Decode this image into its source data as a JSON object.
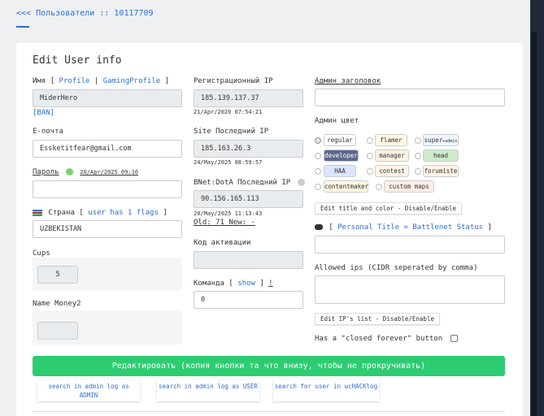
{
  "breadcrumb": "<<< Пользователи :: 10117709",
  "title": "Edit User info",
  "col1": {
    "name_label": "Имя",
    "bracket_open": "[",
    "bracket_close": "]",
    "separator": "|",
    "profile_link": "Profile",
    "gaming_profile_link": "GamingProfile",
    "name_value": "MiderHero",
    "ban_link": "[BAN]",
    "email_label": "E-почта",
    "email_value": "Essketitfear@gmail.com",
    "password_label": "Пароль",
    "password_date": "20/Apr/2025 09:16",
    "password_value": "",
    "country_label": "Страна",
    "country_flags_link": "user has 1 flags",
    "country_value": "UZBEKISTAN",
    "cups_label": "Cups",
    "cups_value": "5",
    "name_money_label": "Name Money2",
    "name_money_value": ""
  },
  "col2": {
    "reg_ip_label": "Регистрационный IP",
    "reg_ip_value": "185.139.137.37",
    "reg_ip_time": "21/Apr/2020 07:54:21",
    "site_ip_label": "Site Последний IP",
    "site_ip_value": "185.163.26.3",
    "site_ip_time": "24/May/2025 08:59:57",
    "bnet_label": "BNet:DotA Последний IP",
    "bnet_value": "90.156.165.113",
    "bnet_time": "20/May/2025 11:13:43",
    "old_new": "Old: 71 New: -",
    "activation_label": "Код активации",
    "activation_value": "",
    "team_label": "Команда",
    "team_show_link": "show",
    "team_excl": "!",
    "team_value": "0"
  },
  "col3": {
    "admin_header_label": "Админ заголовок",
    "admin_header_value": "",
    "admin_color_label": "Админ цвет",
    "colors": [
      {
        "label": "regular",
        "bg": "#ffffff",
        "fg": "#333333"
      },
      {
        "label": "flamer",
        "bg": "#fff8e1",
        "fg": "#333333"
      },
      {
        "label": "super",
        "bg": "#eef4ff",
        "fg": "#333333"
      },
      {
        "label": "developer",
        "bg": "#5b6a8c",
        "fg": "#ffffff"
      },
      {
        "label": "manager",
        "bg": "#fdf1e0",
        "fg": "#333333"
      },
      {
        "label": "head",
        "bg": "#cfeacb",
        "fg": "#333333"
      },
      {
        "label": "HAA",
        "bg": "#dde6ff",
        "fg": "#333333"
      },
      {
        "label": "contest",
        "bg": "#fdf4e6",
        "fg": "#333333"
      },
      {
        "label": "forumiste",
        "bg": "#fdf4e6",
        "fg": "#333333"
      },
      {
        "label": "contentmaker",
        "bg": "#fff8e1",
        "fg": "#333333"
      },
      {
        "label": "custom maps",
        "bg": "#fdeee8",
        "fg": "#333333"
      }
    ],
    "super_suffix": "+admin",
    "edit_title_btn": "Edit title and color - Disable/Enable",
    "personal_title_link": "Personal Title = Battlenet Status",
    "personal_title_value": "",
    "allowed_ips_label": "Allowed ips (CIDR seperated by comma)",
    "allowed_ips_value": "",
    "edit_ips_btn": "Edit IP's list - Disable/Enable",
    "closed_forever_label": "Has a \"closed forever\" button"
  },
  "main_button": "Редактировать (копия кнопки та что внизу, чтобы не прокручивать)",
  "links": [
    "search in admin log as ADMIN",
    "search in admin log as USER",
    "search for user in wcHACKlog"
  ]
}
